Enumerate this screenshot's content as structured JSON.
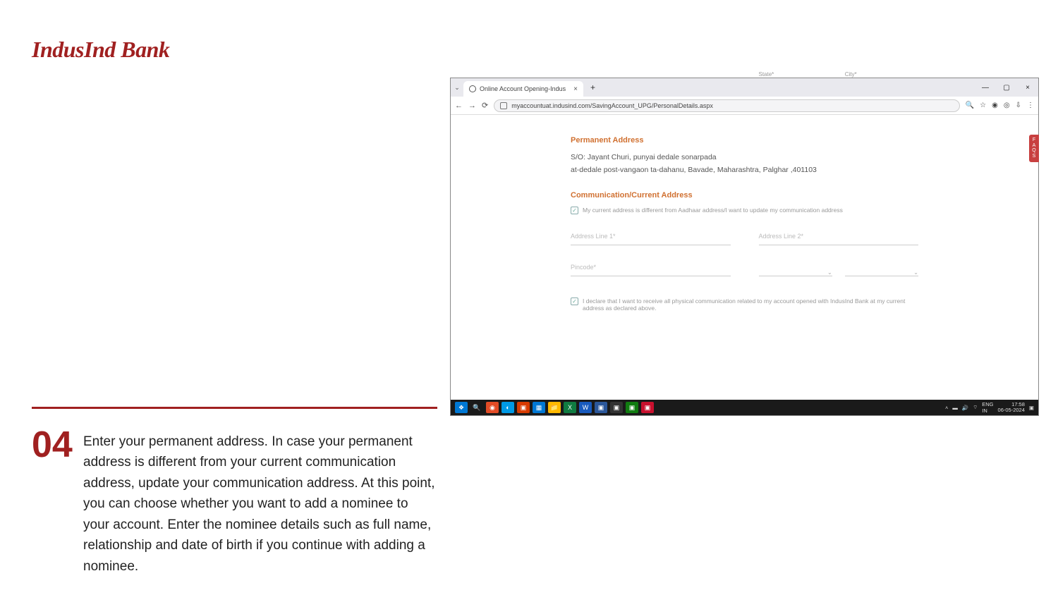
{
  "logo_text": "IndusInd Bank",
  "step_number": "04",
  "step_description": "Enter your permanent address. In case your permanent address is different from your current communication address, update your communication address. At this point, you can choose whether you want to add a nominee to your account. Enter the nominee details such as full name, relationship and date of birth if you continue with adding a nominee.",
  "browser": {
    "tab_title": "Online Account Opening-Indus",
    "url": "myaccountuat.indusind.com/SavingAccount_UPG/PersonalDetails.aspx"
  },
  "form": {
    "permanent_heading": "Permanent Address",
    "perm_line1": "S/O: Jayant Churi, punyai dedale sonarpada",
    "perm_line2": "at-dedale post-vangaon ta-dahanu, Bavade, Maharashtra, Palghar ,401103",
    "comm_heading": "Communication/Current Address",
    "different_checkbox": "My current address is different from Aadhaar address/I want to update my communication address",
    "addr1_ph": "Address Line 1*",
    "addr2_ph": "Address Line 2*",
    "pincode_ph": "Pincode*",
    "state_label": "State*",
    "city_label": "City*",
    "declaration": "I declare that I want to receive all physical communication related to my account opened with IndusInd Bank at my current address as declared above."
  },
  "faqs": "FAQS",
  "taskbar": {
    "lang": "ENG",
    "region": "IN",
    "time": "17:58",
    "date": "06-05-2024"
  }
}
